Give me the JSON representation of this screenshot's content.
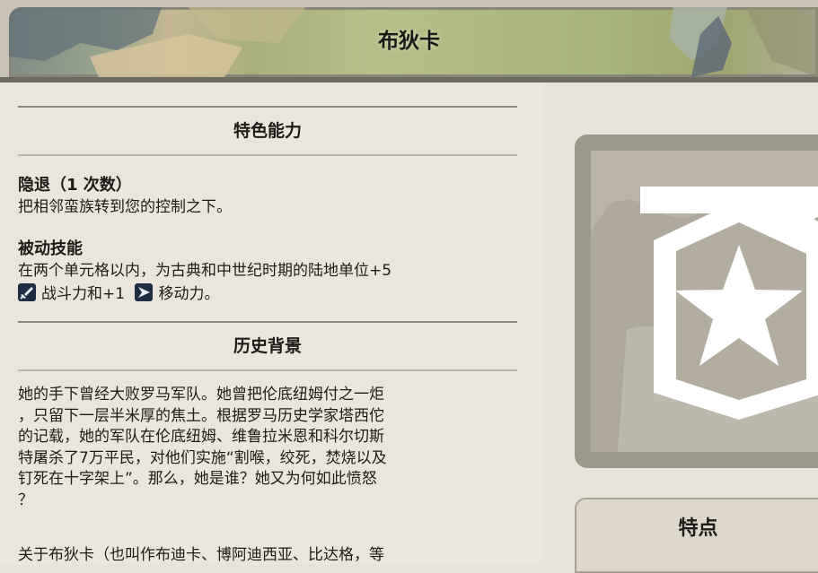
{
  "header": {
    "title": "布狄卡"
  },
  "abilities_section": {
    "header": "特色能力",
    "ability1": {
      "name": "隐退（1 次数）",
      "text": "把相邻蛮族转到您的控制之下。"
    },
    "ability2": {
      "name": "被动技能",
      "line1": "在两个单元格以内，为古典和中世纪时期的陆地单位+5",
      "combat_label": "战斗力和+1",
      "movement_label": "移动力。",
      "combat_icon": "sword-icon",
      "movement_icon": "movement-arrow-icon"
    }
  },
  "history_section": {
    "header": "历史背景",
    "body": "她的手下曾经大败罗马军队。她曾把伦底纽姆付之一炬\n，只留下一层半米厚的焦土。根据罗马历史学家塔西佗\n的记载，她的军队在伦底纽姆、维鲁拉米恩和科尔切斯\n特屠杀了7万平民，对他们实施“割喉，绞死，焚烧以及\n钉死在十字架上”。那么，她是谁？她又为何如此愤怒\n？",
    "about": "关于布狄卡（也叫作布迪卡、博阿迪西亚、比达格，等"
  },
  "right_panel": {
    "emblem_icon": "star-chevron-emblem-icon",
    "traits_label": "特点"
  },
  "colors": {
    "panel_bg": "#ebe6db",
    "icon_bg": "#1d2d44",
    "emblem_white": "#ffffff"
  }
}
